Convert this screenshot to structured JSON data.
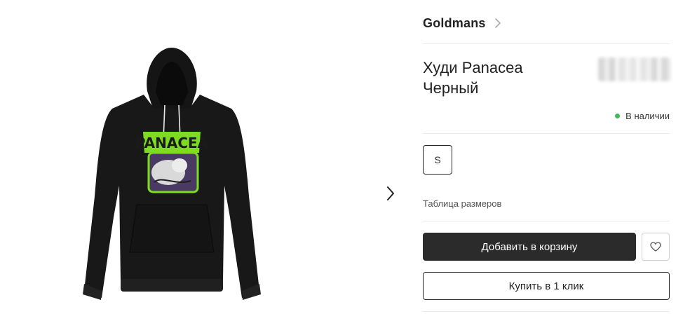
{
  "brand": {
    "name": "Goldmans",
    "icon": "chevron-right-icon"
  },
  "product": {
    "title_line1": "Худи Panacea",
    "title_line2": "Черный",
    "print_text": "PANACEA",
    "image_alt": "Black hoodie with green Panacea print"
  },
  "stock": {
    "label": "В наличии",
    "color": "#3dbb5b"
  },
  "sizes": {
    "options": [
      "S"
    ],
    "selected": "S"
  },
  "size_chart": {
    "label": "Таблица размеров"
  },
  "actions": {
    "add_to_cart": "Добавить в корзину",
    "buy_one_click": "Купить в 1 клик",
    "wishlist_icon": "heart-icon"
  },
  "gallery": {
    "next_icon": "chevron-right-icon"
  },
  "colors": {
    "primary_button": "#2b2b2b",
    "stock_dot": "#3dbb5b",
    "print_green": "#7ddc1f"
  }
}
